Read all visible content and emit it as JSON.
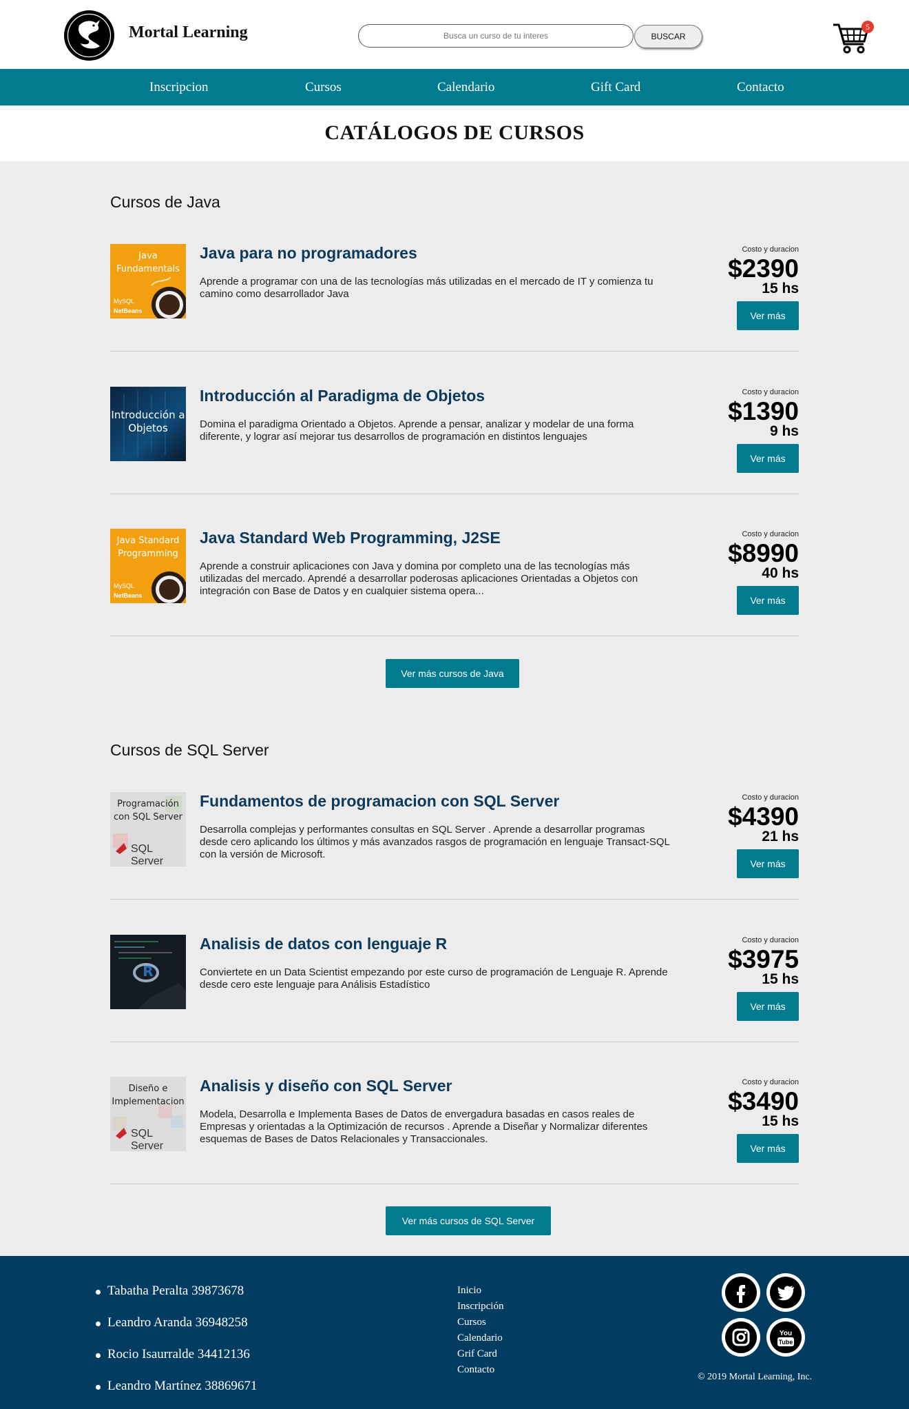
{
  "header": {
    "brand": "Mortal Learning",
    "search_placeholder": "Busca un curso de tu interes",
    "search_button": "BUSCAR",
    "cart_count": "5"
  },
  "nav": {
    "items": [
      {
        "label": "Inscripcion"
      },
      {
        "label": "Cursos"
      },
      {
        "label": "Calendario"
      },
      {
        "label": "Gift Card"
      },
      {
        "label": "Contacto"
      }
    ]
  },
  "page": {
    "title": "CATÁLOGOS DE CURSOS"
  },
  "sections": [
    {
      "title": "Cursos de Java",
      "more_button": "Ver más cursos de Java",
      "courses": [
        {
          "thumb_label": "Java Fundamentals",
          "thumb_logos": [
            "MySQL",
            "NetBeans"
          ],
          "title": "Java para no programadores",
          "description": "Aprende a programar con una de las tecnologías más utilizadas en el mercado de IT y comienza tu camino como desarrollador Java",
          "price_label": "Costo y duracion",
          "price": "$2390",
          "hours": "15 hs",
          "button": "Ver más"
        },
        {
          "thumb_label": "Introducción a Objetos",
          "title": "Introducción al Paradigma de Objetos",
          "description": "Domina el paradigma Orientado a Objetos. Aprende a pensar, analizar y modelar de una forma diferente, y lograr así mejorar tus desarrollos de programación en distintos lenguajes",
          "price_label": "Costo y duracion",
          "price": "$1390",
          "hours": "9 hs",
          "button": "Ver más"
        },
        {
          "thumb_label": "Java Standard Programming",
          "thumb_logos": [
            "MySQL",
            "NetBeans"
          ],
          "title": "Java Standard Web Programming, J2SE",
          "description": "Aprende a construir aplicaciones con Java y domina por completo una de las tecnologías más utilizadas del mercado. Aprendé a desarrollar poderosas aplicaciones Orientadas a Objetos con integración con Base de Datos y en cualquier sistema opera...",
          "price_label": "Costo y duracion",
          "price": "$8990",
          "hours": "40 hs",
          "button": "Ver más"
        }
      ]
    },
    {
      "title": "Cursos de SQL Server",
      "more_button": "Ver más cursos de SQL Server",
      "courses": [
        {
          "thumb_label": "Programación con SQL Server",
          "thumb_logo": "SQL Server",
          "title": "Fundamentos de programacion con SQL Server",
          "description": "Desarrolla complejas y performantes consultas en SQL Server . Aprende a desarrollar programas desde cero aplicando los últimos y más avanzados rasgos de programación en lenguaje Transact-SQL con la versión de Microsoft.",
          "price_label": "Costo y duracion",
          "price": "$4390",
          "hours": "21 hs",
          "button": "Ver más"
        },
        {
          "thumb_label": "R",
          "title": "Analisis de datos con lenguaje R",
          "description": "Conviertete en un Data Scientist empezando por este curso de programación de Lenguaje R. Aprende desde cero este lenguaje para Análisis Estadístico",
          "price_label": "Costo y duracion",
          "price": "$3975",
          "hours": "15 hs",
          "button": "Ver más"
        },
        {
          "thumb_label": "Diseño e Implementacion",
          "thumb_logo": "SQL Server",
          "title": "Analisis y diseño con SQL Server",
          "description": "Modela, Desarrolla e Implementa Bases de Datos de envergadura basadas en casos reales de Empresas y orientadas a la Optimización de recursos . Aprende a Diseñar y Normalizar diferentes esquemas de Bases de Datos Relacionales y Transaccionales.",
          "price_label": "Costo y duracion",
          "price": "$3490",
          "hours": "15 hs",
          "button": "Ver más"
        }
      ]
    }
  ],
  "footer": {
    "members": [
      "Tabatha Peralta 39873678",
      "Leandro Aranda 36948258",
      "Rocio Isaurralde 34412136",
      "Leandro Martínez 38869671"
    ],
    "links": [
      "Inicio",
      "Inscripción",
      "Cursos",
      "Calendario",
      "Grif Card",
      "Contacto"
    ],
    "social": [
      {
        "name": "facebook-icon",
        "glyph": "f"
      },
      {
        "name": "twitter-icon",
        "glyph": "t"
      },
      {
        "name": "instagram-icon",
        "glyph": "◎"
      },
      {
        "name": "youtube-icon",
        "glyph": "You Tube"
      }
    ],
    "copyright": "© 2019 Mortal Learning, Inc."
  },
  "colors": {
    "accent": "#037b8e",
    "footer_bg": "#033c61",
    "title_blue": "#0d3a5c",
    "page_bg": "#ececec"
  }
}
